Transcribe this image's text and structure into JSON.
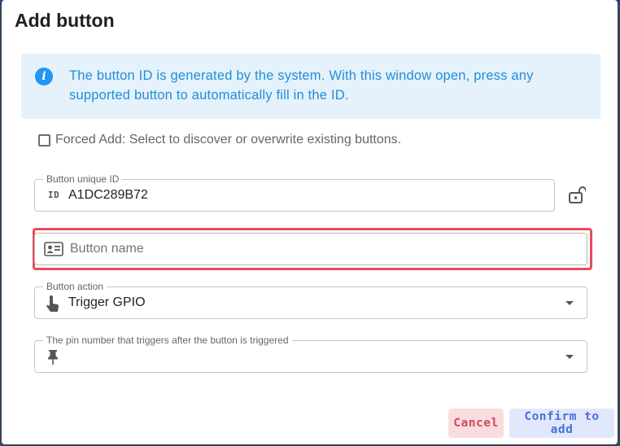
{
  "dialog": {
    "title": "Add button",
    "info_text": "The button ID is generated by the system. With this window open, press any supported button to automatically fill in the ID.",
    "forced_add_label": "Forced Add: Select to discover or overwrite existing buttons.",
    "forced_add_checked": false
  },
  "fields": {
    "unique_id": {
      "label": "Button unique ID",
      "prefix": "ID",
      "value": "A1DC289B72"
    },
    "name": {
      "placeholder": "Button name",
      "value": ""
    },
    "action": {
      "label": "Button action",
      "value": "Trigger GPIO"
    },
    "pin": {
      "label": "The pin number that triggers after the button is triggered",
      "value": ""
    }
  },
  "icons": {
    "info": "info-icon",
    "lock": "lock-open-icon",
    "name": "id-card-icon",
    "action": "hand-pointer-icon",
    "pin": "pushpin-icon"
  },
  "buttons": {
    "cancel": "Cancel",
    "confirm": "Confirm to add"
  },
  "colors": {
    "accent": "#2196f3",
    "highlight": "#e94b5d",
    "cancel": "#d14a5a",
    "confirm": "#4a6fd8"
  }
}
